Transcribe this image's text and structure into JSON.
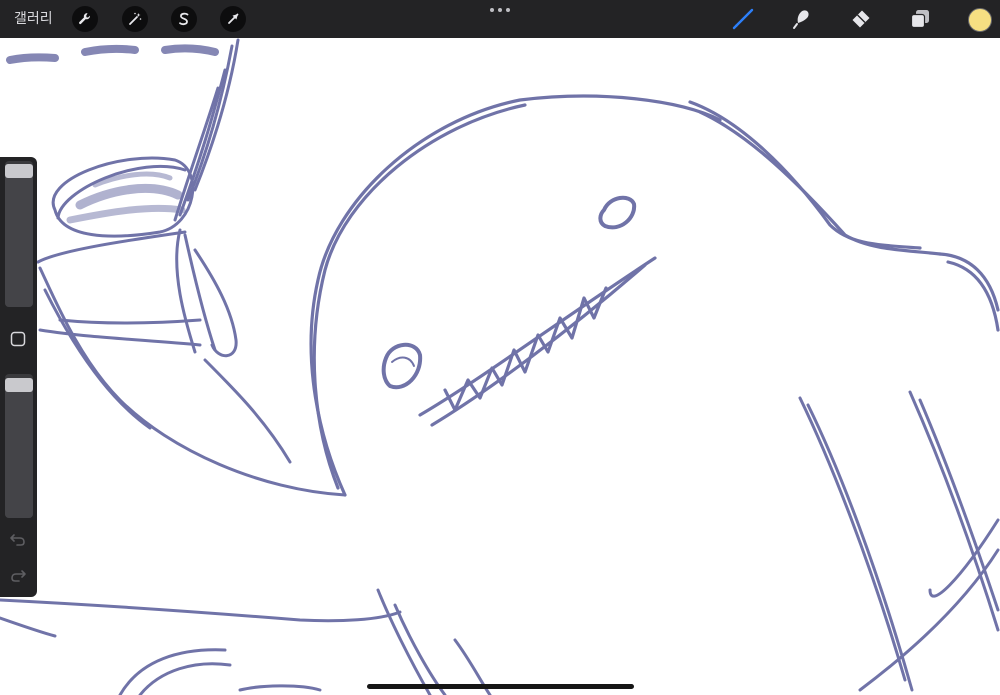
{
  "toolbar": {
    "gallery_label": "갤러리",
    "left_tools": [
      {
        "name": "actions",
        "icon": "wrench-icon"
      },
      {
        "name": "adjustments",
        "icon": "magic-wand-icon"
      },
      {
        "name": "selection",
        "icon": "selection-s-icon"
      },
      {
        "name": "transform",
        "icon": "arrow-cursor-icon"
      }
    ],
    "center_icon": "more-dots-icon",
    "right_tools": [
      {
        "name": "brush",
        "icon": "brush-icon",
        "active": true
      },
      {
        "name": "smudge",
        "icon": "smudge-finger-icon",
        "active": false
      },
      {
        "name": "eraser",
        "icon": "eraser-icon",
        "active": false
      },
      {
        "name": "layers",
        "icon": "layers-icon",
        "active": false
      }
    ],
    "current_color": "#f6df82"
  },
  "sidebar": {
    "brush_size_level": 0.98,
    "opacity_level": 0.97,
    "modify_icon": "square-modify-icon",
    "undo_icon": "undo-icon",
    "redo_icon": "redo-icon"
  },
  "colors": {
    "toolbar_bg": "#232325",
    "active_tool": "#2d7ff9",
    "inactive_tool": "#e6e6ea",
    "stroke": "#6f72a8",
    "canvas": "#ffffff"
  }
}
